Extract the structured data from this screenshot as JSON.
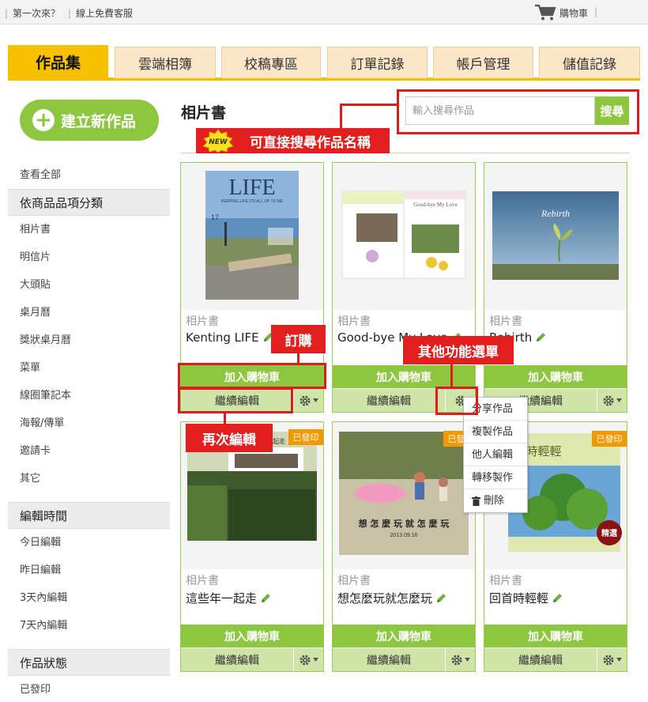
{
  "topbar": {
    "first_time": "第一次來？",
    "online_service": "線上免費客服",
    "cart": "購物車"
  },
  "tabs": [
    {
      "label": "作品集",
      "active": true
    },
    {
      "label": "雲端相簿"
    },
    {
      "label": "校稿專區"
    },
    {
      "label": "訂單記錄"
    },
    {
      "label": "帳戶管理"
    },
    {
      "label": "儲值記錄"
    }
  ],
  "create_button": "建立新作品",
  "sidebar": {
    "view_all": "查看全部",
    "by_category": "依商品品項分類",
    "categories": [
      "相片書",
      "明信片",
      "大頭貼",
      "桌月曆",
      "獎狀桌月曆",
      "菜單",
      "線圈筆記本",
      "海報/傳單",
      "邀請卡",
      "其它"
    ],
    "by_time": "編輯時間",
    "times": [
      "今日編輯",
      "昨日編輯",
      "3天內編輯",
      "7天內編輯"
    ],
    "by_status": "作品狀態",
    "statuses": [
      "已發印"
    ]
  },
  "main": {
    "title": "相片書",
    "search_placeholder": "輸入搜尋作品",
    "search_button": "搜尋"
  },
  "annotations": {
    "new_badge": "NEW",
    "search_hint": "可直接搜尋作品名稱",
    "order": "訂購",
    "more_menu": "其他功能選單",
    "re_edit": "再次編輯"
  },
  "cards": [
    {
      "category": "相片書",
      "name": "Kenting LIFE",
      "cart": "加入購物車",
      "edit": "繼續編輯",
      "badge": ""
    },
    {
      "category": "相片書",
      "name": "Good-bye My Love",
      "cart": "加入購物車",
      "edit": "繼續編輯",
      "badge": ""
    },
    {
      "category": "相片書",
      "name": "Rebirth",
      "cart": "加入購物車",
      "edit": "繼續編輯",
      "badge": ""
    },
    {
      "category": "相片書",
      "name": "這些年一起走",
      "cart": "加入購物車",
      "edit": "繼續編輯",
      "badge": "已發印"
    },
    {
      "category": "相片書",
      "name": "想怎麼玩就怎麼玩",
      "cart": "加入購物車",
      "edit": "繼續編輯",
      "badge": "已發印"
    },
    {
      "category": "相片書",
      "name": "回首時輕輕",
      "cart": "加入購物車",
      "edit": "繼續編輯",
      "badge": "已發印"
    }
  ],
  "thumb_text": {
    "life": "LIFE",
    "life_sub": "KEEPING LIFE ITS ALL UP TO ME",
    "life_num": "17",
    "goodbye": "Good-bye My Love",
    "rebirth": "Rebirth",
    "together": "這些年．起走",
    "play": "想 怎 麼 玩 就 怎 麼 玩",
    "play_date": "2013.09.16",
    "look_back": "時輕輕",
    "look_back_stamp": "精選"
  },
  "menu": [
    "分享作品",
    "複製作品",
    "他人編輯",
    "轉移製作",
    "刪除"
  ],
  "colors": {
    "green": "#8dc63f",
    "yellow": "#f7c100",
    "red": "#e31e1e",
    "orange": "#f39800"
  }
}
